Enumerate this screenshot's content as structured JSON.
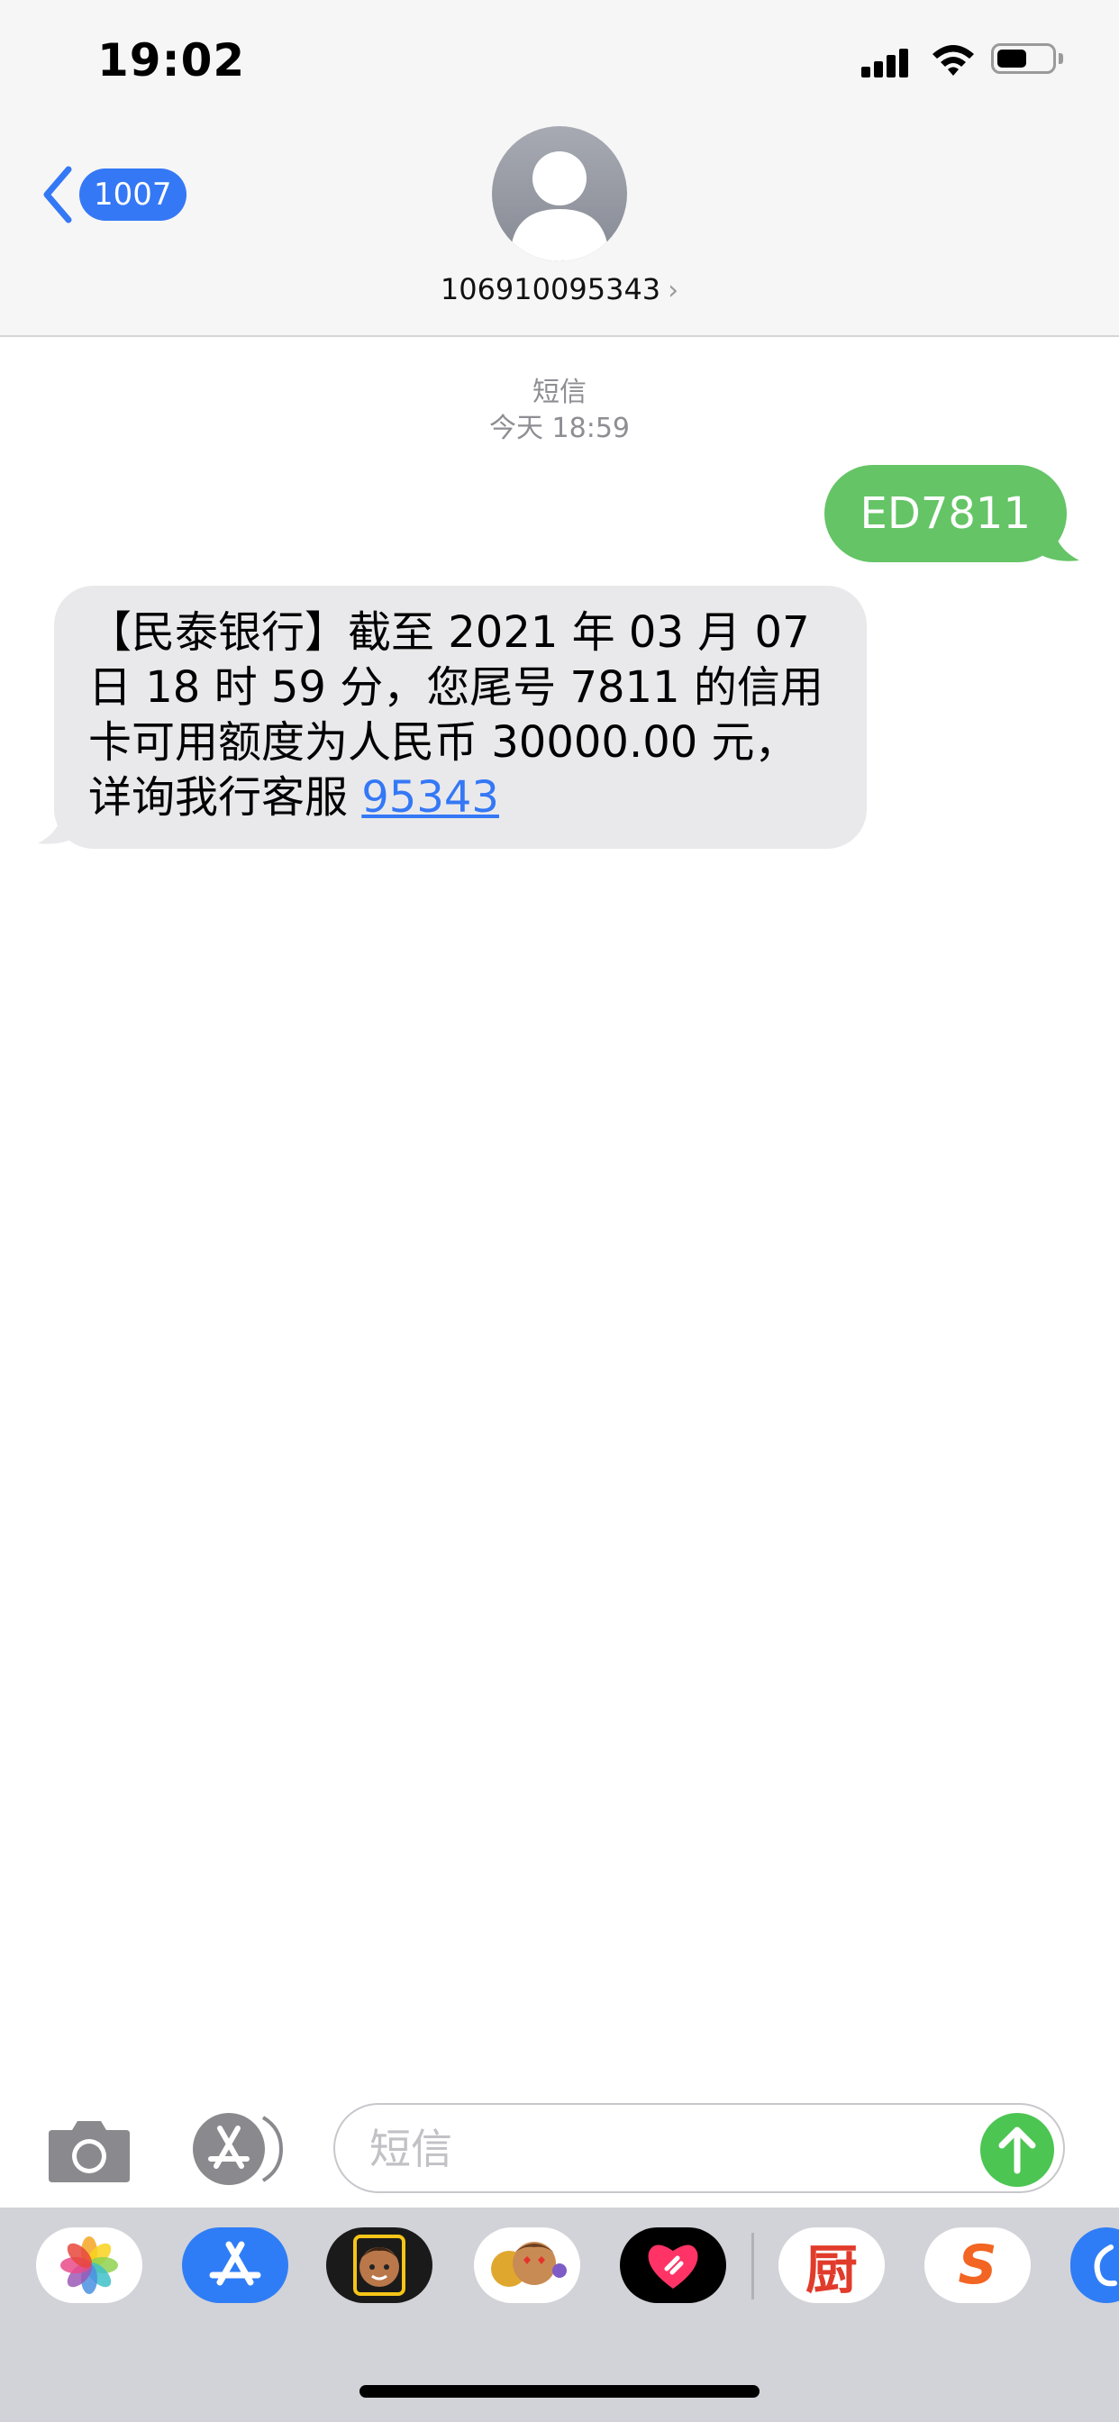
{
  "status_bar": {
    "time": "19:02"
  },
  "nav": {
    "back_count": "1007",
    "contact": "106910095343",
    "chevron": "›"
  },
  "thread": {
    "label": "短信",
    "timestamp": "今天 18:59",
    "messages": [
      {
        "direction": "sent",
        "text": "ED7811"
      },
      {
        "direction": "received",
        "text": "【民泰银行】截至 2021 年 03 月 07 日 18 时 59 分，您尾号 7811 的信用卡可用额度为人民币 30000.00 元，详询我行客服 ",
        "link": "95343"
      }
    ]
  },
  "input": {
    "placeholder": "短信"
  },
  "apps": [
    {
      "name": "photos",
      "label": ""
    },
    {
      "name": "app-store",
      "label": ""
    },
    {
      "name": "memoji",
      "label": ""
    },
    {
      "name": "animoji-stickers",
      "label": ""
    },
    {
      "name": "digital-touch",
      "label": ""
    },
    {
      "name": "xiachufang",
      "label": "厨"
    },
    {
      "name": "sogou",
      "label": "S"
    },
    {
      "name": "more",
      "label": ""
    }
  ],
  "colors": {
    "accent": "#3478f6",
    "sent_bubble": "#65c466",
    "received_bubble": "#e9e9eb",
    "send": "#4cc552"
  }
}
